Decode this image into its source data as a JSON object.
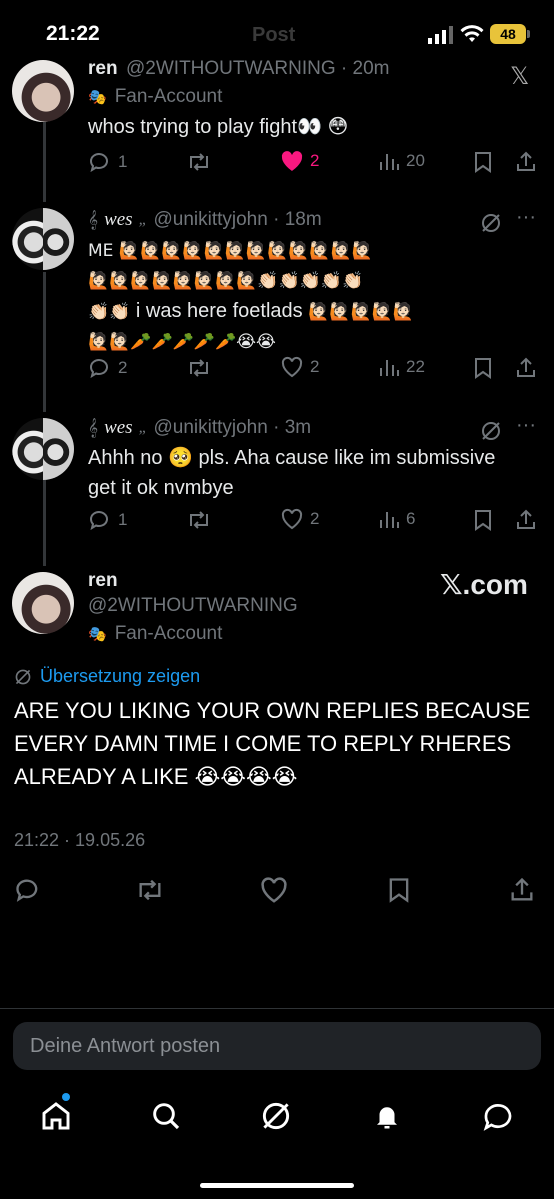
{
  "status_bar": {
    "time": "21:22",
    "header_label": "Post",
    "battery": "48"
  },
  "tweets": [
    {
      "name": "ren",
      "handle": "@2WITHOUTWARNING · 20m",
      "label": "Fan-Account",
      "text": "whos trying to play fight👀 😳",
      "replies": "1",
      "likes": "2",
      "views": "20"
    },
    {
      "name": "wes",
      "handle": "@unikittyjohn · 18m",
      "text_line1": "ME 🙋🏻🙋🏻🙋🏻🙋🏻🙋🏻🙋🏻🙋🏻🙋🏻🙋🏻🙋🏻🙋🏻🙋🏻",
      "text_line2": "🙋🏻🙋🏻🙋🏻🙋🏻🙋🏻🙋🏻🙋🏻🙋🏻👏🏻👏🏻👏🏻👏🏻👏🏻",
      "text_line3_a": "👏🏻👏🏻",
      "text_line3_b": "i was here foetlads",
      "text_line3_c": "🙋🏻🙋🏻🙋🏻🙋🏻🙋🏻",
      "text_line4": "🙋🏻🙋🏻🥕🥕🥕🥕🥕😭😭",
      "replies": "2",
      "likes": "2",
      "views": "22"
    },
    {
      "name": "wes",
      "handle": "@unikittyjohn · 3m",
      "text_line1": "Ahhh no 🥺 pls. Aha cause like im submissive",
      "text_line2": "get it ok nvmbye",
      "replies": "1",
      "likes": "2",
      "views": "6"
    }
  ],
  "main_post": {
    "name": "ren",
    "handle": "@2WITHOUTWARNING",
    "label": "Fan-Account",
    "watermark": "𝕏.com",
    "translate_link": "Übersetzung zeigen",
    "text": "ARE YOU LIKING YOUR OWN REPLIES BECAUSE EVERY DAMN TIME I COME TO REPLY RHERES ALREADY A LIKE 😭😭😭😭",
    "timestamp": "21:22 · 19.05.26"
  },
  "reply_box": {
    "placeholder": "Deine Antwort posten"
  },
  "colors": {
    "accent": "#1d9bf0",
    "like": "#f91880",
    "muted": "#71767b"
  }
}
